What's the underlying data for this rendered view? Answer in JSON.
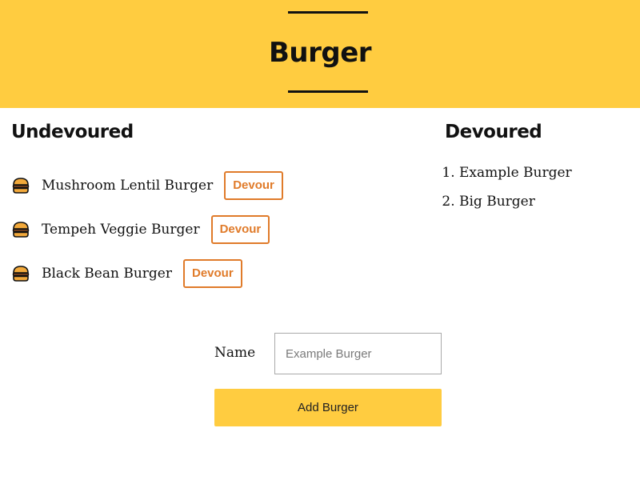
{
  "header": {
    "title": "Burger"
  },
  "undevoured": {
    "title": "Undevoured",
    "items": [
      {
        "name": "Mushroom Lentil Burger",
        "button_label": "Devour",
        "icon": "burger-icon"
      },
      {
        "name": "Tempeh Veggie Burger",
        "button_label": "Devour",
        "icon": "burger-icon"
      },
      {
        "name": "Black Bean Burger",
        "button_label": "Devour",
        "icon": "burger-icon"
      }
    ]
  },
  "devoured": {
    "title": "Devoured",
    "items": [
      {
        "name": "Example Burger"
      },
      {
        "name": "Big Burger"
      }
    ]
  },
  "form": {
    "label": "Name",
    "placeholder": "Example Burger",
    "value": "",
    "submit_label": "Add Burger"
  },
  "colors": {
    "accent_yellow": "#ffcc40",
    "devour_orange": "#e07b2a",
    "text": "#111111"
  }
}
